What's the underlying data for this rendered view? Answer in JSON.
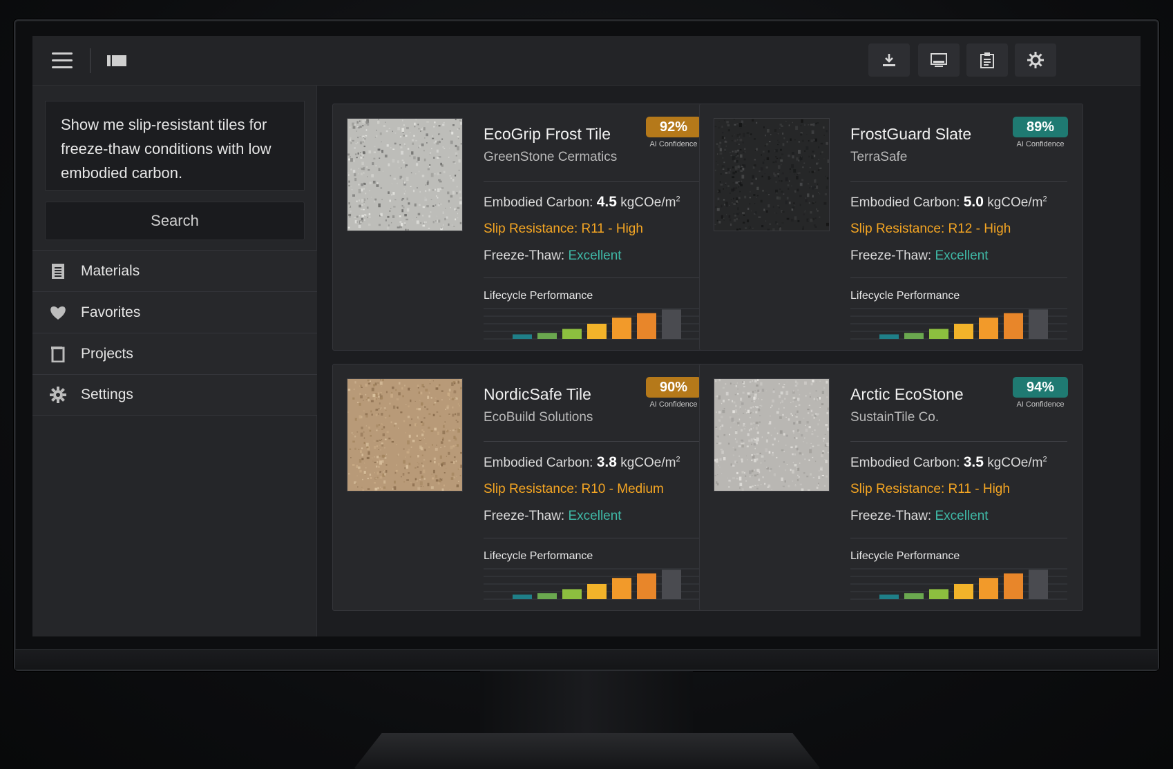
{
  "topbar": {
    "icons": [
      "menu-icon",
      "sidebar-panel-icon",
      "download-icon",
      "monitor-icon",
      "clipboard-icon",
      "gear-icon"
    ]
  },
  "sidebar": {
    "query": "Show me slip-resistant tiles for freeze-thaw conditions with low embodied carbon.",
    "search_label": "Search",
    "nav": [
      {
        "label": "Materials",
        "icon": "document-list-icon"
      },
      {
        "label": "Favorites",
        "icon": "heart-icon"
      },
      {
        "label": "Projects",
        "icon": "folder-icon"
      },
      {
        "label": "Settings",
        "icon": "gear-icon"
      }
    ]
  },
  "cards": [
    {
      "name": "EcoGrip Frost Tile",
      "maker": "GreenStone Cermatics",
      "confidence": "92%",
      "confidence_label": "AI Confidence",
      "badge_color": "#b5791a",
      "carbon_label": "Embodied Carbon:",
      "carbon_value": "4.5",
      "carbon_unit": "kgCOe/m",
      "carbon_sup": "2",
      "slip_label": "Slip Resistance:",
      "slip_value": "R11 - High",
      "freeze_label": "Freeze-Thaw:",
      "freeze_value": "Excellent",
      "lifecycle_label": "Lifecycle Performance",
      "swatch": "light-grey-speckled"
    },
    {
      "name": "FrostGuard Slate",
      "maker": "TerraSafe",
      "confidence": "89%",
      "confidence_label": "AI Confidence",
      "badge_color": "#1f7a72",
      "carbon_label": "Embodied Carbon:",
      "carbon_value": "5.0",
      "carbon_unit": "kgCOe/m",
      "carbon_sup": "2",
      "slip_label": "Slip Resistance:",
      "slip_value": "R12 - High",
      "freeze_label": "Freeze-Thaw:",
      "freeze_value": "Excellent",
      "lifecycle_label": "Lifecycle Performance",
      "swatch": "dark-slate"
    },
    {
      "name": "NordicSafe Tile",
      "maker": "EcoBuild Solutions",
      "confidence": "90%",
      "confidence_label": "AI Confidence",
      "badge_color": "#b5791a",
      "carbon_label": "Embodied Carbon:",
      "carbon_value": "3.8",
      "carbon_unit": "kgCOe/m",
      "carbon_sup": "2",
      "slip_label": "Slip Resistance:",
      "slip_value": "R10 - Medium",
      "freeze_label": "Freeze-Thaw:",
      "freeze_value": "Excellent",
      "lifecycle_label": "Lifecycle Performance",
      "swatch": "beige-sand"
    },
    {
      "name": "Arctic EcoStone",
      "maker": "SustainTile Co.",
      "confidence": "94%",
      "confidence_label": "AI Confidence",
      "badge_color": "#1f7a72",
      "carbon_label": "Embodied Carbon:",
      "carbon_value": "3.5",
      "carbon_unit": "kgCOe/m",
      "carbon_sup": "2",
      "slip_label": "Slip Resistance:",
      "slip_value": "R11 - High",
      "freeze_label": "Freeze-Thaw:",
      "freeze_value": "Excellent",
      "lifecycle_label": "Lifecycle Performance",
      "swatch": "light-stone"
    }
  ],
  "chart_data": {
    "type": "bar",
    "values": [
      0.15,
      0.2,
      0.33,
      0.5,
      0.7,
      0.85,
      0.97
    ],
    "colors": [
      "#1f7f88",
      "#6aa84f",
      "#8cbf3f",
      "#f2b32a",
      "#f29a2a",
      "#e8862a",
      "#4a4b50"
    ]
  },
  "colors": {
    "accent_orange": "#f5a623",
    "accent_teal": "#3fb8a6"
  }
}
